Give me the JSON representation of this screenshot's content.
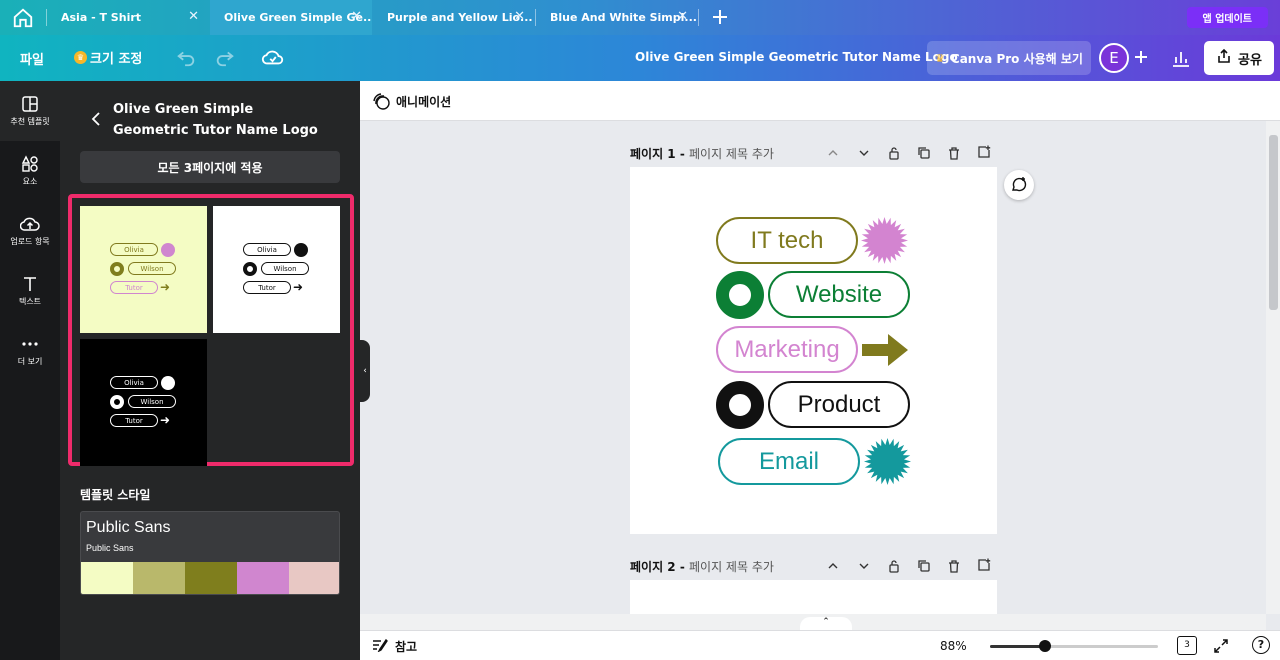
{
  "tabs": [
    {
      "label": "Asia - T Shirt",
      "active": false
    },
    {
      "label": "Olive Green Simple Ge...",
      "active": true
    },
    {
      "label": "Purple and Yellow Lio...",
      "active": false
    },
    {
      "label": "Blue And White Simpl...",
      "active": false
    }
  ],
  "app_update_label": "앱 업데이트",
  "toolbar": {
    "file_label": "파일",
    "resize_label": "크기 조정",
    "doc_title": "Olive Green Simple Geometric Tutor Name Logo",
    "pro_label": "Canva Pro 사용해 보기",
    "avatar_initial": "E",
    "share_label": "공유"
  },
  "rail": [
    {
      "label": "추천 템플릿",
      "icon": "template-icon"
    },
    {
      "label": "요소",
      "icon": "elements-icon"
    },
    {
      "label": "업로드 항목",
      "icon": "upload-icon"
    },
    {
      "label": "텍스트",
      "icon": "text-icon"
    },
    {
      "label": "더 보기",
      "icon": "more-icon"
    }
  ],
  "panel": {
    "title": "Olive Green Simple Geometric Tutor Name Logo",
    "apply_label": "모든 3페이지에 적용",
    "thumb_texts": [
      "Olivia",
      "Wilson",
      "Tutor"
    ],
    "style_title": "템플릿 스타일",
    "style_font": "Public Sans",
    "style_font_small": "Public Sans",
    "palette": [
      "#f4fcc4",
      "#b9b86b",
      "#7f7e1d",
      "#d086cf",
      "#e8c8c4"
    ]
  },
  "canvas": {
    "animation_label": "애니메이션",
    "page1_label": "페이지 1 - ",
    "page1_sub": "페이지 제목 추가",
    "page2_label": "페이지 2 - ",
    "page2_sub": "페이지 제목 추가",
    "design": [
      {
        "text": "IT tech",
        "color": "#807a1e",
        "badge": "starburst",
        "badge_color": "#d384d0"
      },
      {
        "text": "Website",
        "color": "#0c7f35",
        "badge": "ring",
        "badge_color": "#0c7f35"
      },
      {
        "text": "Marketing",
        "color": "#d384d0",
        "badge": "arrow",
        "badge_color": "#807a1e"
      },
      {
        "text": "Product",
        "color": "#111111",
        "badge": "ring",
        "badge_color": "#111111"
      },
      {
        "text": "Email",
        "color": "#14999d",
        "badge": "starburst",
        "badge_color": "#14999d"
      }
    ]
  },
  "bottom": {
    "notes_label": "참고",
    "zoom": "88%",
    "zoom_fraction": 0.33,
    "page_count": "3"
  },
  "colors": {
    "accent": "#7b2ff7",
    "highlight_frame": "#ef2b6b"
  }
}
